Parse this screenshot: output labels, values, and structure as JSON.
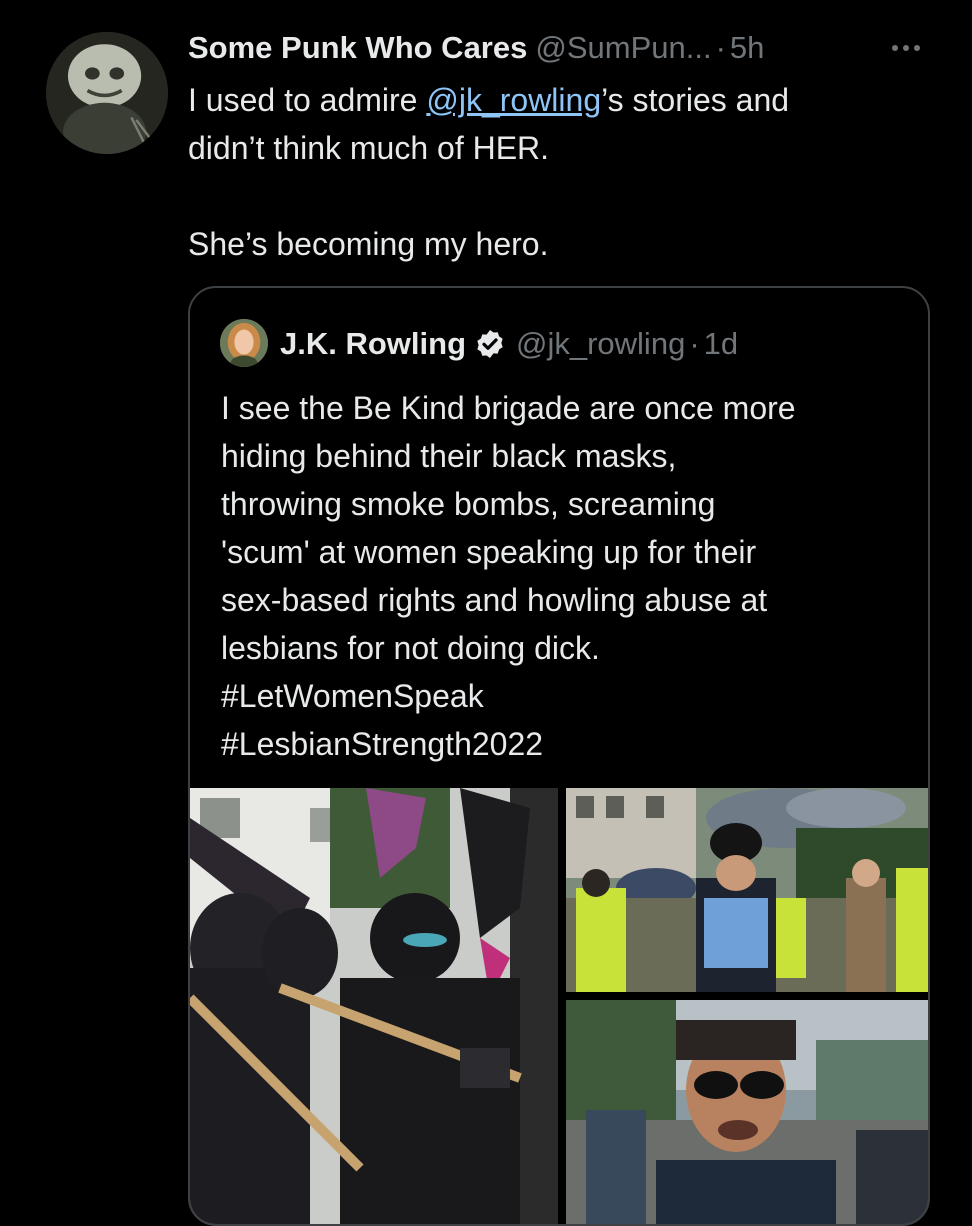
{
  "tweet": {
    "author": {
      "name": "Some Punk Who Cares",
      "handle": "@SumPun...",
      "time": "5h"
    },
    "text": {
      "line1_before": "I used to admire ",
      "mention": "@jk_rowling",
      "line1_after": "’s stories and",
      "line2": "didn’t think much of HER.",
      "line3": "She’s becoming my hero."
    }
  },
  "quoted_tweet": {
    "author": {
      "name": "J.K. Rowling",
      "handle": "@jk_rowling",
      "time": "1d"
    },
    "text": [
      "I see the Be Kind brigade are once more",
      "hiding behind their black masks,",
      "throwing smoke bombs, screaming",
      "'scum' at women speaking up for their",
      "sex-based rights and howling abuse at",
      "lesbians for not doing dick."
    ],
    "hashtags": [
      "#LetWomenSpeak",
      "#LesbianStrength2022"
    ],
    "media_count": 3
  },
  "icons": {
    "more": "more-horizontal-icon",
    "verified": "verified-badge-icon"
  },
  "colors": {
    "background": "#000000",
    "text_primary": "#e7e9ea",
    "text_secondary": "#71767b",
    "mention": "#8ec5f6",
    "border": "#3e4144"
  },
  "separator": "·"
}
